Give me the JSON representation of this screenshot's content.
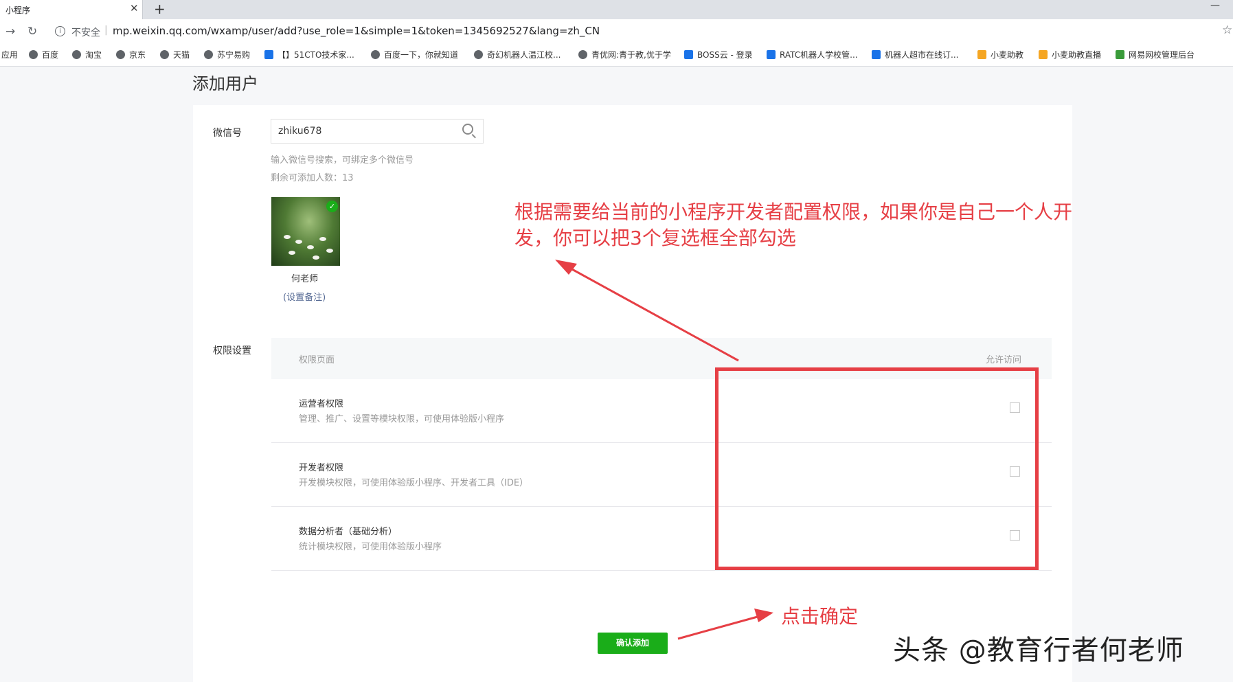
{
  "browser": {
    "tab_title": "小程序",
    "tab_close": "✕",
    "new_tab": "+",
    "insecure_label": "不安全",
    "url": "mp.weixin.qq.com/wxamp/user/add?use_role=1&simple=1&token=1345692527&lang=zh_CN",
    "bookmarks": [
      "应用",
      "百度",
      "淘宝",
      "京东",
      "天猫",
      "苏宁易购",
      "【】51CTO技术家...",
      "百度一下，你就知道",
      "奇幻机器人温江校...",
      "青优网:青于教,优于学",
      "BOSS云 - 登录",
      "RATC机器人学校管...",
      "机器人超市在线订...",
      "小麦助教",
      "小麦助教直播",
      "网易网校管理后台"
    ]
  },
  "page": {
    "title": "添加用户",
    "wechat_label": "微信号",
    "search_value": "zhiku678",
    "search_hint": "输入微信号搜索，可绑定多个微信号",
    "remaining_label": "剩余可添加人数：13",
    "user_name": "何老师",
    "remark_link": "(设置备注)",
    "permission_label": "权限设置",
    "table": {
      "col_page": "权限页面",
      "col_allow": "允许访问",
      "rows": [
        {
          "name": "运营者权限",
          "desc": "管理、推广、设置等模块权限，可使用体验版小程序"
        },
        {
          "name": "开发者权限",
          "desc": "开发模块权限，可使用体验版小程序、开发者工具（IDE）"
        },
        {
          "name": "数据分析者（基础分析）",
          "desc": "统计模块权限，可使用体验版小程序"
        }
      ]
    },
    "confirm_button": "确认添加"
  },
  "annotations": {
    "main_note": "根据需要给当前的小程序开发者配置权限，如果你是自己一个人开发，你可以把3个复选框全部勾选",
    "confirm_note": "点击确定",
    "watermark": "头条 @教育行者何老师"
  },
  "colors": {
    "annotation_red": "#e63f45",
    "wechat_green": "#1aad19",
    "link_blue": "#576b95"
  }
}
